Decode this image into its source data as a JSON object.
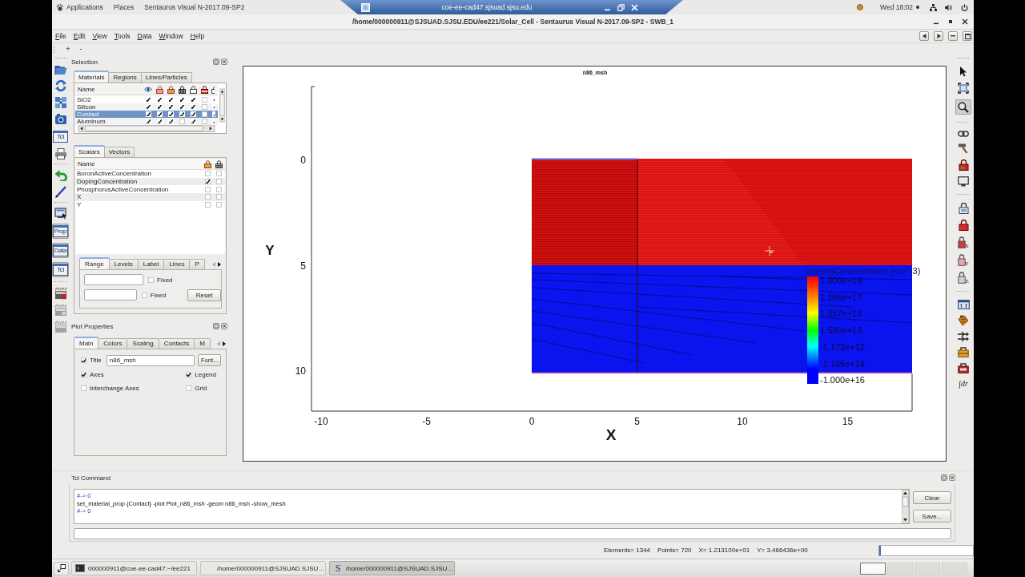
{
  "top_bar": {
    "menus": [
      "Applications",
      "Places"
    ],
    "app_name": "Sentaurus Visual N-2017.09-SP2",
    "remote_host": "coe-ee-cad47.sjsuad.sjsu.edu",
    "clock": "Wed 18:02"
  },
  "window": {
    "title": "/home/000000911@SJSUAD.SJSU.EDU/ee221/Solar_Cell - Sentaurus Visual N-2017.09-SP2 - SWB_1"
  },
  "menu_bar": [
    "File",
    "Edit",
    "View",
    "Tools",
    "Data",
    "Window",
    "Help"
  ],
  "toolbar": [
    "+",
    "-"
  ],
  "left_toolbar": [
    {
      "label": "Tcl",
      "pressed": false
    },
    {
      "label": "Prop",
      "pressed": true
    },
    {
      "label": "Data",
      "pressed": true
    },
    {
      "label": "Tcl",
      "pressed": true
    }
  ],
  "selection": {
    "title": "Selection",
    "tabs": [
      {
        "label": "Materials",
        "selected": true
      },
      {
        "label": "Regions",
        "selected": false
      },
      {
        "label": "Lines/Particles",
        "selected": false
      }
    ],
    "column": "Name",
    "rows": [
      {
        "name": "SiO2",
        "selected": false,
        "checks": [
          true,
          true,
          true,
          true,
          true,
          false,
          true
        ]
      },
      {
        "name": "Silicon",
        "selected": false,
        "checks": [
          true,
          true,
          true,
          true,
          true,
          false,
          true
        ]
      },
      {
        "name": "Contact",
        "selected": true,
        "checks": [
          true,
          true,
          true,
          true,
          true,
          false,
          true
        ]
      },
      {
        "name": "Aluminum",
        "selected": false,
        "checks": [
          true,
          true,
          true,
          false,
          true,
          false,
          true
        ]
      }
    ]
  },
  "scalars": {
    "tabs": [
      {
        "label": "Scalars",
        "selected": true
      },
      {
        "label": "Vectors",
        "selected": false
      }
    ],
    "column": "Name",
    "rows": [
      {
        "name": "BoronActiveConcentration",
        "checks": [
          false,
          false
        ]
      },
      {
        "name": "DopingConcentration",
        "checks": [
          true,
          false
        ]
      },
      {
        "name": "PhosphorusActiveConcentration",
        "checks": [
          false,
          false
        ]
      },
      {
        "name": "X",
        "checks": [
          false,
          false
        ]
      },
      {
        "name": "Y",
        "checks": [
          false,
          false
        ]
      }
    ]
  },
  "range": {
    "tabs": [
      {
        "label": "Range",
        "selected": true
      },
      {
        "label": "Levels",
        "selected": false
      },
      {
        "label": "Label",
        "selected": false
      },
      {
        "label": "Lines",
        "selected": false
      },
      {
        "label": "P",
        "selected": false
      }
    ],
    "fields": [
      {
        "fixed_label": "Fixed",
        "fixed": false
      },
      {
        "fixed_label": "Fixed",
        "fixed": false
      }
    ],
    "reset": "Reset"
  },
  "plot_properties": {
    "title": "Plot Properties",
    "tabs": [
      {
        "label": "Main",
        "selected": true
      },
      {
        "label": "Colors",
        "selected": false
      },
      {
        "label": "Scaling",
        "selected": false
      },
      {
        "label": "Contacts",
        "selected": false
      },
      {
        "label": "M",
        "selected": false
      }
    ],
    "title_option": {
      "label": "Title",
      "checked": true,
      "value": "n86_msh"
    },
    "font_button": "Font...",
    "options": [
      {
        "label": "Axes",
        "checked": true
      },
      {
        "label": "Legend",
        "checked": true
      },
      {
        "label": "Interchange Axes",
        "checked": false
      },
      {
        "label": "Grid",
        "checked": false
      }
    ]
  },
  "plot": {
    "title": "n86_msh",
    "x_label": "X",
    "y_label": "Y",
    "x_ticks": [
      "-10",
      "-5",
      "0",
      "5",
      "10",
      "15"
    ],
    "y_ticks": [
      "0",
      "5",
      "10"
    ],
    "legend": {
      "title": "DopingConcentration (cm^-3)",
      "values": [
        "1.000e+19",
        "1.165e+17",
        "1.357e+15",
        "1.580e+13",
        "-1.173e+12",
        "-1.165e+14",
        "-1.000e+16"
      ]
    }
  },
  "right_toolbar": {
    "magnifier_pressed": true,
    "lock_labels": [
      "X",
      "Y",
      "Z"
    ],
    "integral_label": "∫dr"
  },
  "tcl": {
    "title": "Tcl Command",
    "lines": [
      {
        "kind": "result",
        "text": "#-> 0"
      },
      {
        "kind": "command",
        "text": "set_material_prop {Contact} -plot Plot_n86_msh -geom n86_msh -show_mesh"
      },
      {
        "kind": "result",
        "text": "#-> 0"
      }
    ],
    "buttons": [
      "Clear",
      "Save..."
    ]
  },
  "status_bar": {
    "items": [
      "Elements= 1344",
      "Points= 720",
      "X= 1.213100e+01",
      "Y= 3.466436e+00"
    ]
  },
  "taskbar": {
    "items": [
      {
        "kind": "terminal",
        "label": "000000911@coe-ee-cad47:~/ee221",
        "selected": false
      },
      {
        "kind": "blank",
        "label": "/home/000000911@SJSUAD.SJSU…",
        "selected": false
      },
      {
        "kind": "logo",
        "logo": "S",
        "label": "/home/000000911@SJSUAD.SJSU…",
        "selected": true
      }
    ],
    "workspaces": [
      {
        "selected": true
      },
      {
        "selected": false
      },
      {
        "selected": false
      },
      {
        "selected": false
      }
    ]
  }
}
